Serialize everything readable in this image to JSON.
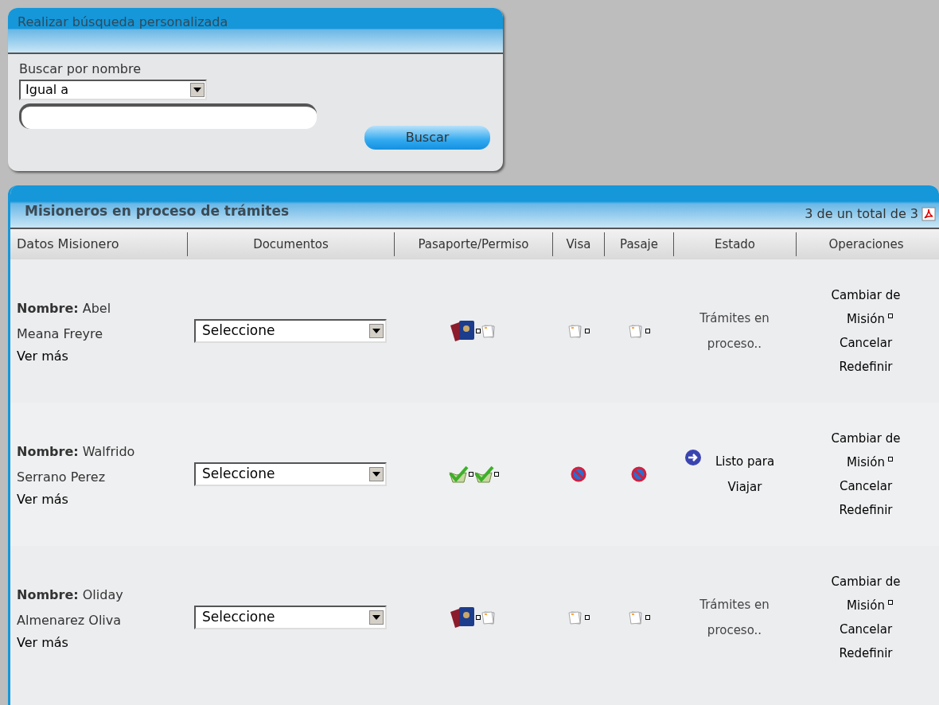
{
  "search_panel": {
    "title": "Realizar búsqueda personalizada",
    "label": "Buscar por nombre",
    "match_select": {
      "value": "Igual a"
    },
    "button": "Buscar"
  },
  "results_panel": {
    "title": "Misioneros en proceso de trámites",
    "count": "3 de un total de 3",
    "columns": [
      "Datos Misionero",
      "Documentos",
      "Pasaporte/Permiso",
      "Visa",
      "Pasaje",
      "Estado",
      "Operaciones"
    ],
    "rows": [
      {
        "name": "**Nombre:** Abel Meana Freyre",
        "more": "Ver más",
        "documents": "Seleccione",
        "passport": {
          "kind": "pending"
        },
        "visa": {
          "kind": "pending"
        },
        "ticket": {
          "kind": "pending"
        },
        "status": {
          "kind": "pending",
          "text": "Trámites en proceso.."
        },
        "operations": [
          "Cambiar de Misión",
          "Cancelar",
          "Redefinir"
        ]
      },
      {
        "name": "**Nombre:** Walfrido Serrano Perez",
        "more": "Ver más",
        "documents": "Seleccione",
        "passport": {
          "kind": "approved"
        },
        "visa": {
          "kind": "blocked"
        },
        "ticket": {
          "kind": "blocked"
        },
        "status": {
          "kind": "ready",
          "text": "Listo para Viajar"
        },
        "operations": [
          "Cambiar de Misión",
          "Cancelar",
          "Redefinir"
        ]
      },
      {
        "name": "**Nombre:** Oliday Almenarez Oliva",
        "more": "Ver más",
        "documents": "Seleccione",
        "passport": {
          "kind": "pending"
        },
        "visa": {
          "kind": "pending"
        },
        "ticket": {
          "kind": "pending"
        },
        "status": {
          "kind": "pending",
          "text": "Trámites en proceso.."
        },
        "operations": [
          "Cambiar de Misión",
          "Cancelar",
          "Redefinir"
        ]
      }
    ]
  }
}
